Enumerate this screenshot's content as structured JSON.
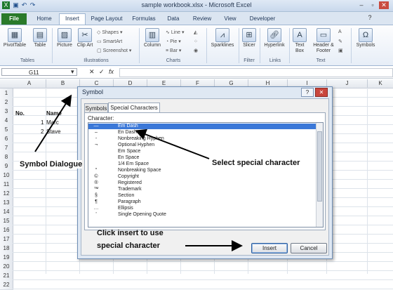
{
  "window": {
    "title": "sample workbook.xlsx - Microsoft Excel"
  },
  "qat": {
    "icons": [
      "excel-logo-icon",
      "save-icon",
      "undo-icon",
      "redo-icon"
    ]
  },
  "window_controls": {
    "minimize": "–",
    "restore": "▫",
    "close": "✕"
  },
  "tabs": [
    "File",
    "Home",
    "Insert",
    "Page Layout",
    "Formulas",
    "Data",
    "Review",
    "View",
    "Developer"
  ],
  "active_tab": "Insert",
  "ribbon": {
    "pivottable": "PivotTable",
    "table": "Table",
    "picture": "Picture",
    "clip_art": "Clip Art",
    "shapes": "Shapes ▾",
    "smartart": "SmartArt",
    "screenshot": "Screenshot ▾",
    "column": "Column",
    "line": "Line ▾",
    "pie": "Pie ▾",
    "bar": "Bar ▾",
    "sparklines": "Sparklines",
    "slicer": "Slicer",
    "hyperlink": "Hyperlink",
    "text_box": "Text Box",
    "header_footer": "Header & Footer",
    "symbols": "Symbols",
    "groups": {
      "tables": "Tables",
      "illustrations": "Illustrations",
      "charts": "Charts",
      "filter": "Filter",
      "links": "Links",
      "text": "Text"
    }
  },
  "formula_bar": {
    "name_box": "G11",
    "cancel": "✕",
    "enter": "✓",
    "fx": "fx"
  },
  "sheet": {
    "columns": [
      "A",
      "B",
      "C",
      "D",
      "E",
      "F",
      "G",
      "H",
      "I",
      "J",
      "K"
    ],
    "rows": [
      "1",
      "2",
      "3",
      "4",
      "5",
      "6",
      "7",
      "8",
      "9",
      "10",
      "11",
      "12",
      "13",
      "14",
      "15",
      "16",
      "17",
      "18",
      "19",
      "20",
      "21",
      "22"
    ],
    "cells": {
      "a3": "No.",
      "b3": "Name",
      "a4": "1",
      "b4": "Marc",
      "a5": "2",
      "b5": "Stave"
    }
  },
  "dialog": {
    "title": "Symbol",
    "help": "?",
    "close": "✕",
    "tabs": [
      "Symbols",
      "Special Characters"
    ],
    "character_label": "Character:",
    "characters": [
      {
        "glyph": "—",
        "name": "Em Dash"
      },
      {
        "glyph": "–",
        "name": "En Dash"
      },
      {
        "glyph": "-",
        "name": "Nonbreaking Hyphen"
      },
      {
        "glyph": "¬",
        "name": "Optional Hyphen"
      },
      {
        "glyph": "",
        "name": "Em Space"
      },
      {
        "glyph": "",
        "name": "En Space"
      },
      {
        "glyph": "",
        "name": "1/4 Em Space"
      },
      {
        "glyph": "°",
        "name": "Nonbreaking Space"
      },
      {
        "glyph": "©",
        "name": "Copyright"
      },
      {
        "glyph": "®",
        "name": "Registered"
      },
      {
        "glyph": "™",
        "name": "Trademark"
      },
      {
        "glyph": "§",
        "name": "Section"
      },
      {
        "glyph": "¶",
        "name": "Paragraph"
      },
      {
        "glyph": "…",
        "name": "Ellipsis"
      },
      {
        "glyph": "'",
        "name": "Single Opening Quote"
      }
    ],
    "selected_index": 0,
    "insert": "Insert",
    "cancel": "Cancel"
  },
  "annotations": {
    "symbol_dialogue": "Symbol Dialogue",
    "select_special": "Select special character",
    "click_insert_line1": "Click insert to use",
    "click_insert_line2": "special character"
  }
}
